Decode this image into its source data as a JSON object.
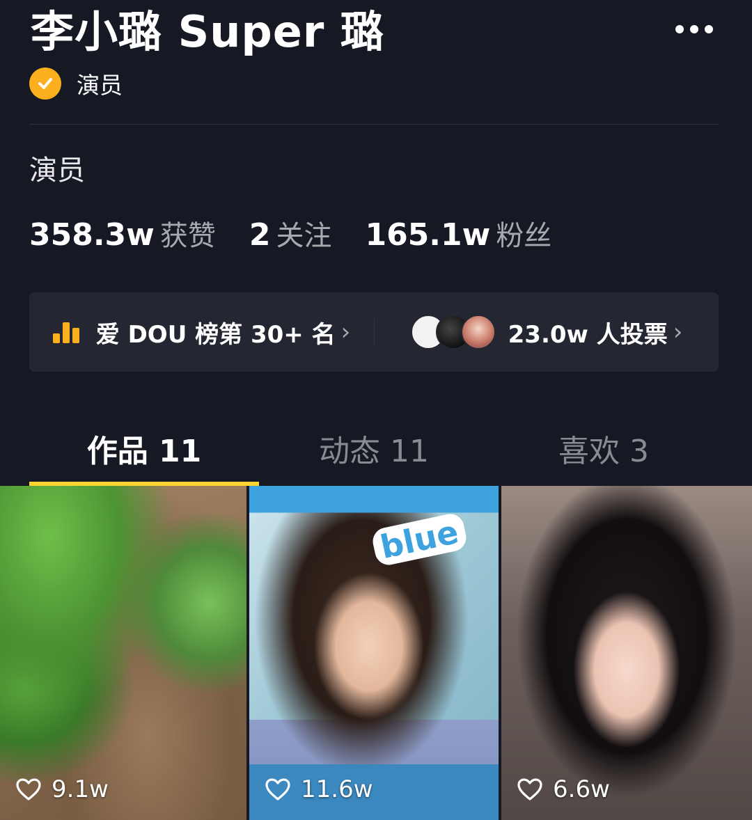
{
  "profile": {
    "name": "李小璐 Super 璐",
    "verified_label": "演员",
    "bio": "演员"
  },
  "stats": [
    {
      "value": "358.3w",
      "label": "获赞"
    },
    {
      "value": "2",
      "label": "关注"
    },
    {
      "value": "165.1w",
      "label": "粉丝"
    }
  ],
  "rank_card": {
    "rank_text": "爱 DOU 榜第 30+ 名",
    "votes_text": "23.0w 人投票"
  },
  "tabs": [
    {
      "label": "作品 11",
      "active": true
    },
    {
      "label": "动态 11",
      "active": false
    },
    {
      "label": "喜欢 3",
      "active": false
    }
  ],
  "videos": [
    {
      "likes": "9.1w"
    },
    {
      "likes": "11.6w",
      "sticker": "blue"
    },
    {
      "likes": "6.6w"
    }
  ],
  "colors": {
    "background": "#161823",
    "accent": "#fdb01d",
    "tab_indicator": "#fdd430",
    "card": "#242631"
  },
  "icons": [
    "more-icon",
    "verified-check-icon",
    "bar-chart-icon",
    "chevron-right-icon",
    "heart-icon"
  ]
}
